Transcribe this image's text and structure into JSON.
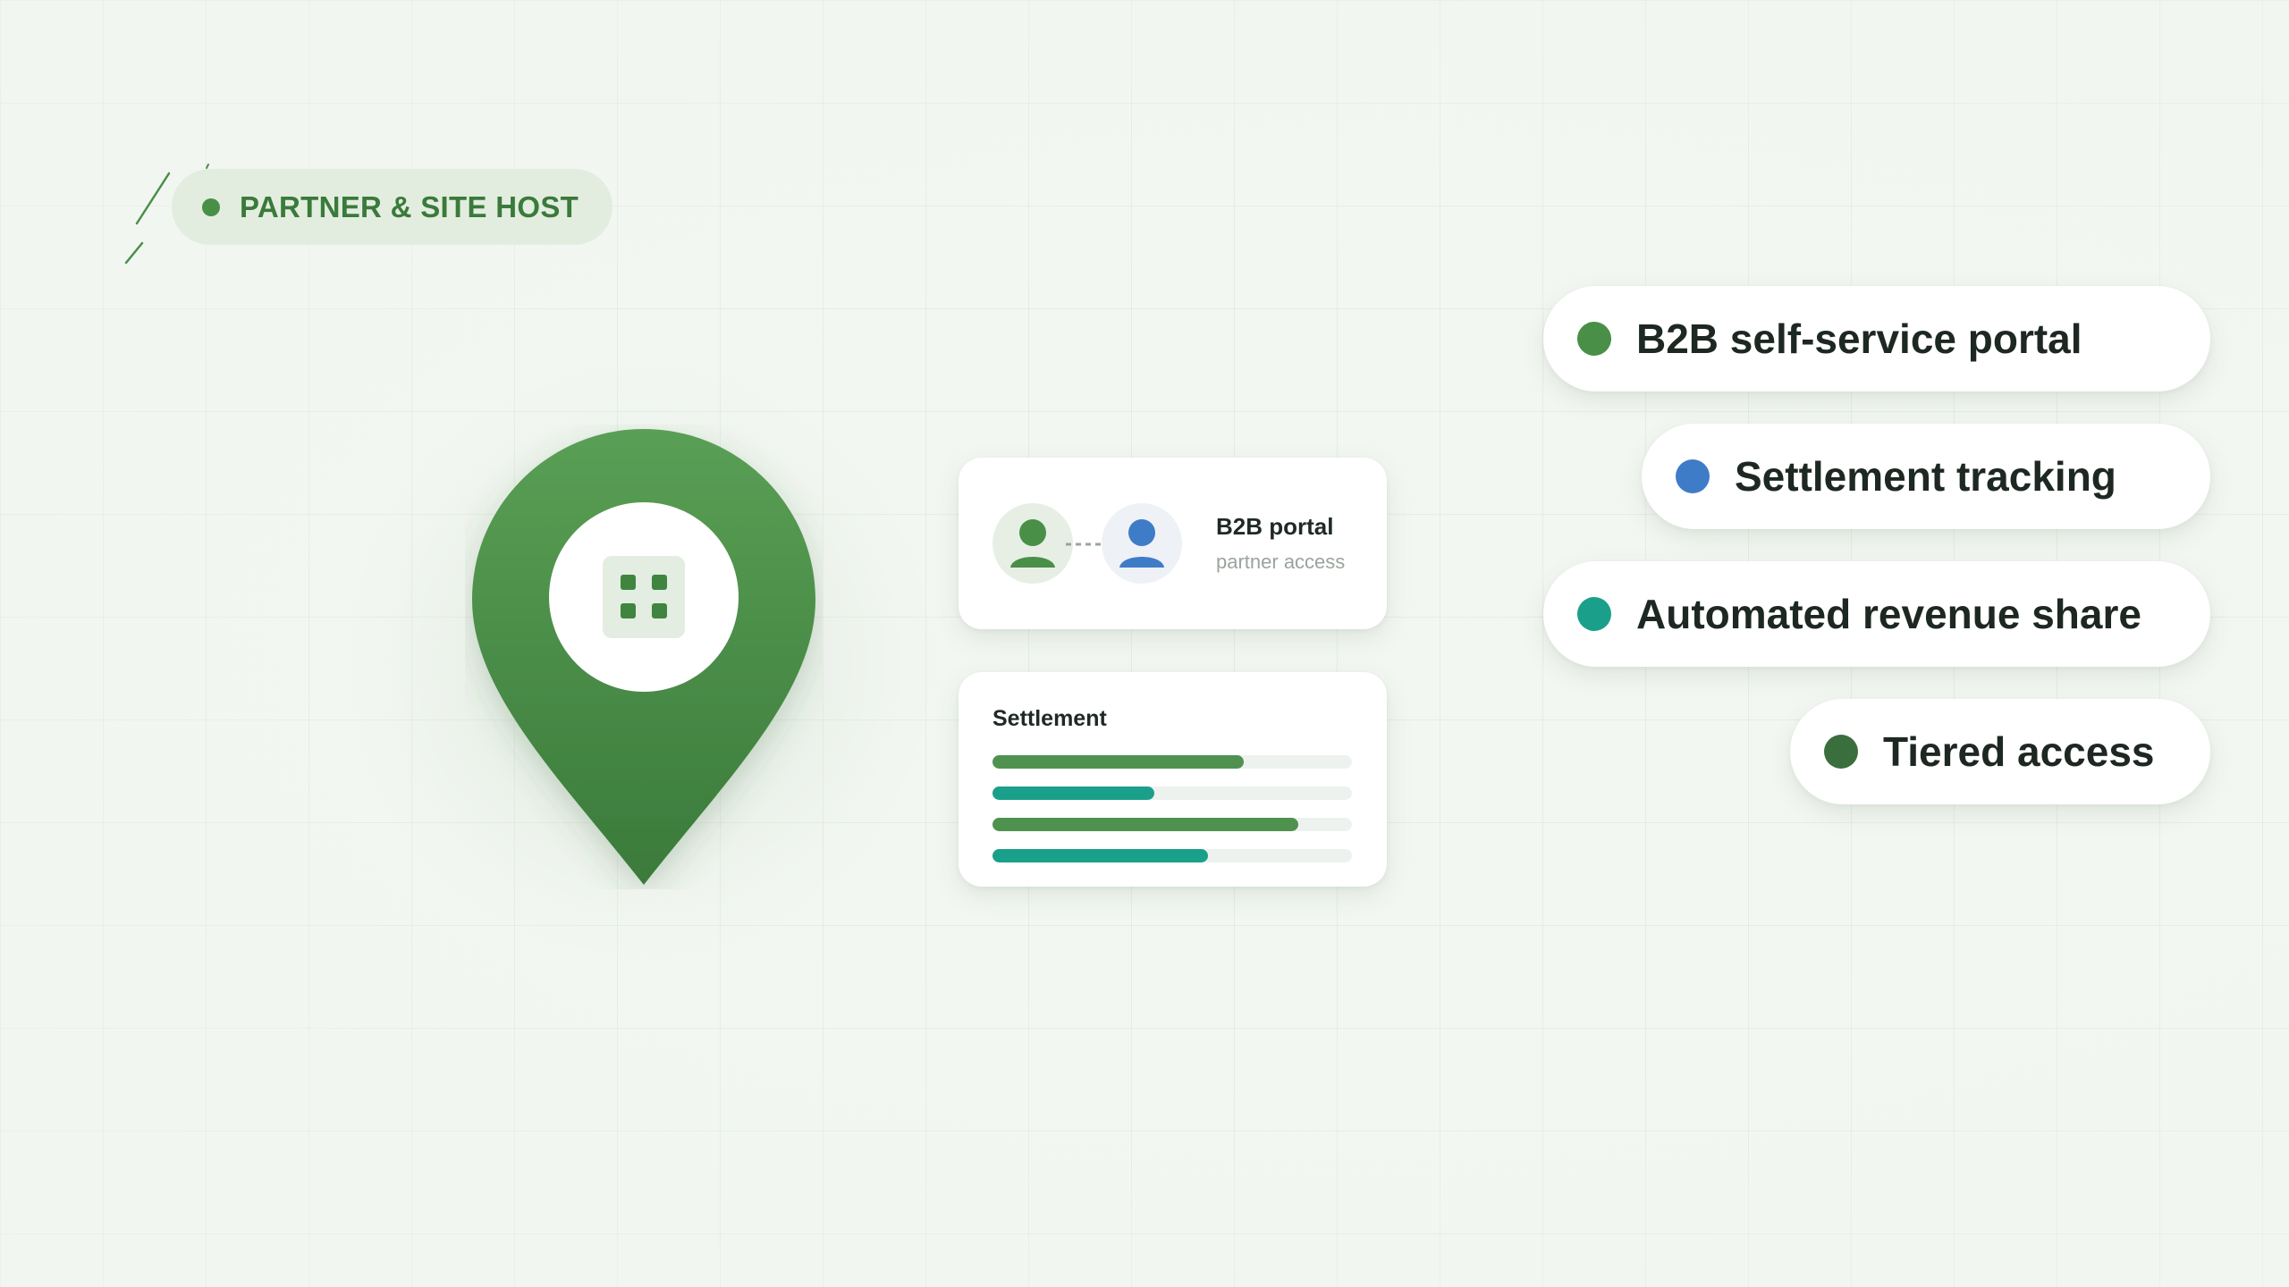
{
  "badge": {
    "label": "PARTNER & SITE HOST",
    "dot_color": "#4a8f48"
  },
  "pin": {
    "icon": "grid-icon",
    "color_top": "#5a9f55",
    "color_bottom": "#3a7a3b"
  },
  "portal_card": {
    "title": "B2B portal",
    "subtitle": "partner access",
    "avatars": [
      "user-green-icon",
      "user-blue-icon"
    ]
  },
  "settlement_card": {
    "title": "Settlement",
    "bars": [
      {
        "fraction": 0.7,
        "color": "#4f9250"
      },
      {
        "fraction": 0.45,
        "color": "#1aa08a"
      },
      {
        "fraction": 0.85,
        "color": "#4f9250"
      },
      {
        "fraction": 0.6,
        "color": "#1aa08a"
      }
    ]
  },
  "features": [
    {
      "label": "B2B self-service portal",
      "dot_color": "#4a8f48"
    },
    {
      "label": "Settlement tracking",
      "dot_color": "#3f7cc8"
    },
    {
      "label": "Automated revenue share",
      "dot_color": "#1aa08a"
    },
    {
      "label": "Tiered access",
      "dot_color": "#3a6e3d"
    }
  ]
}
